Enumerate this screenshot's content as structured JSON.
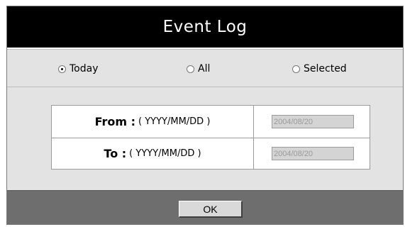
{
  "dialog": {
    "title": "Event Log"
  },
  "filter": {
    "options": [
      {
        "label": "Today",
        "checked": true
      },
      {
        "label": "All",
        "checked": false
      },
      {
        "label": "Selected",
        "checked": false
      }
    ]
  },
  "date_range": {
    "from_label": "From :",
    "from_hint": "( YYYY/MM/DD )",
    "from_value": "2004/08/20",
    "to_label": "To :",
    "to_hint": "( YYYY/MM/DD )",
    "to_value": "2004/08/20"
  },
  "footer": {
    "ok_label": "OK"
  },
  "colors": {
    "title_bg": "#000000",
    "panel_bg": "#e3e3e3",
    "footer_bg": "#6e6e6e",
    "disabled_input_bg": "#d4d4d4"
  }
}
